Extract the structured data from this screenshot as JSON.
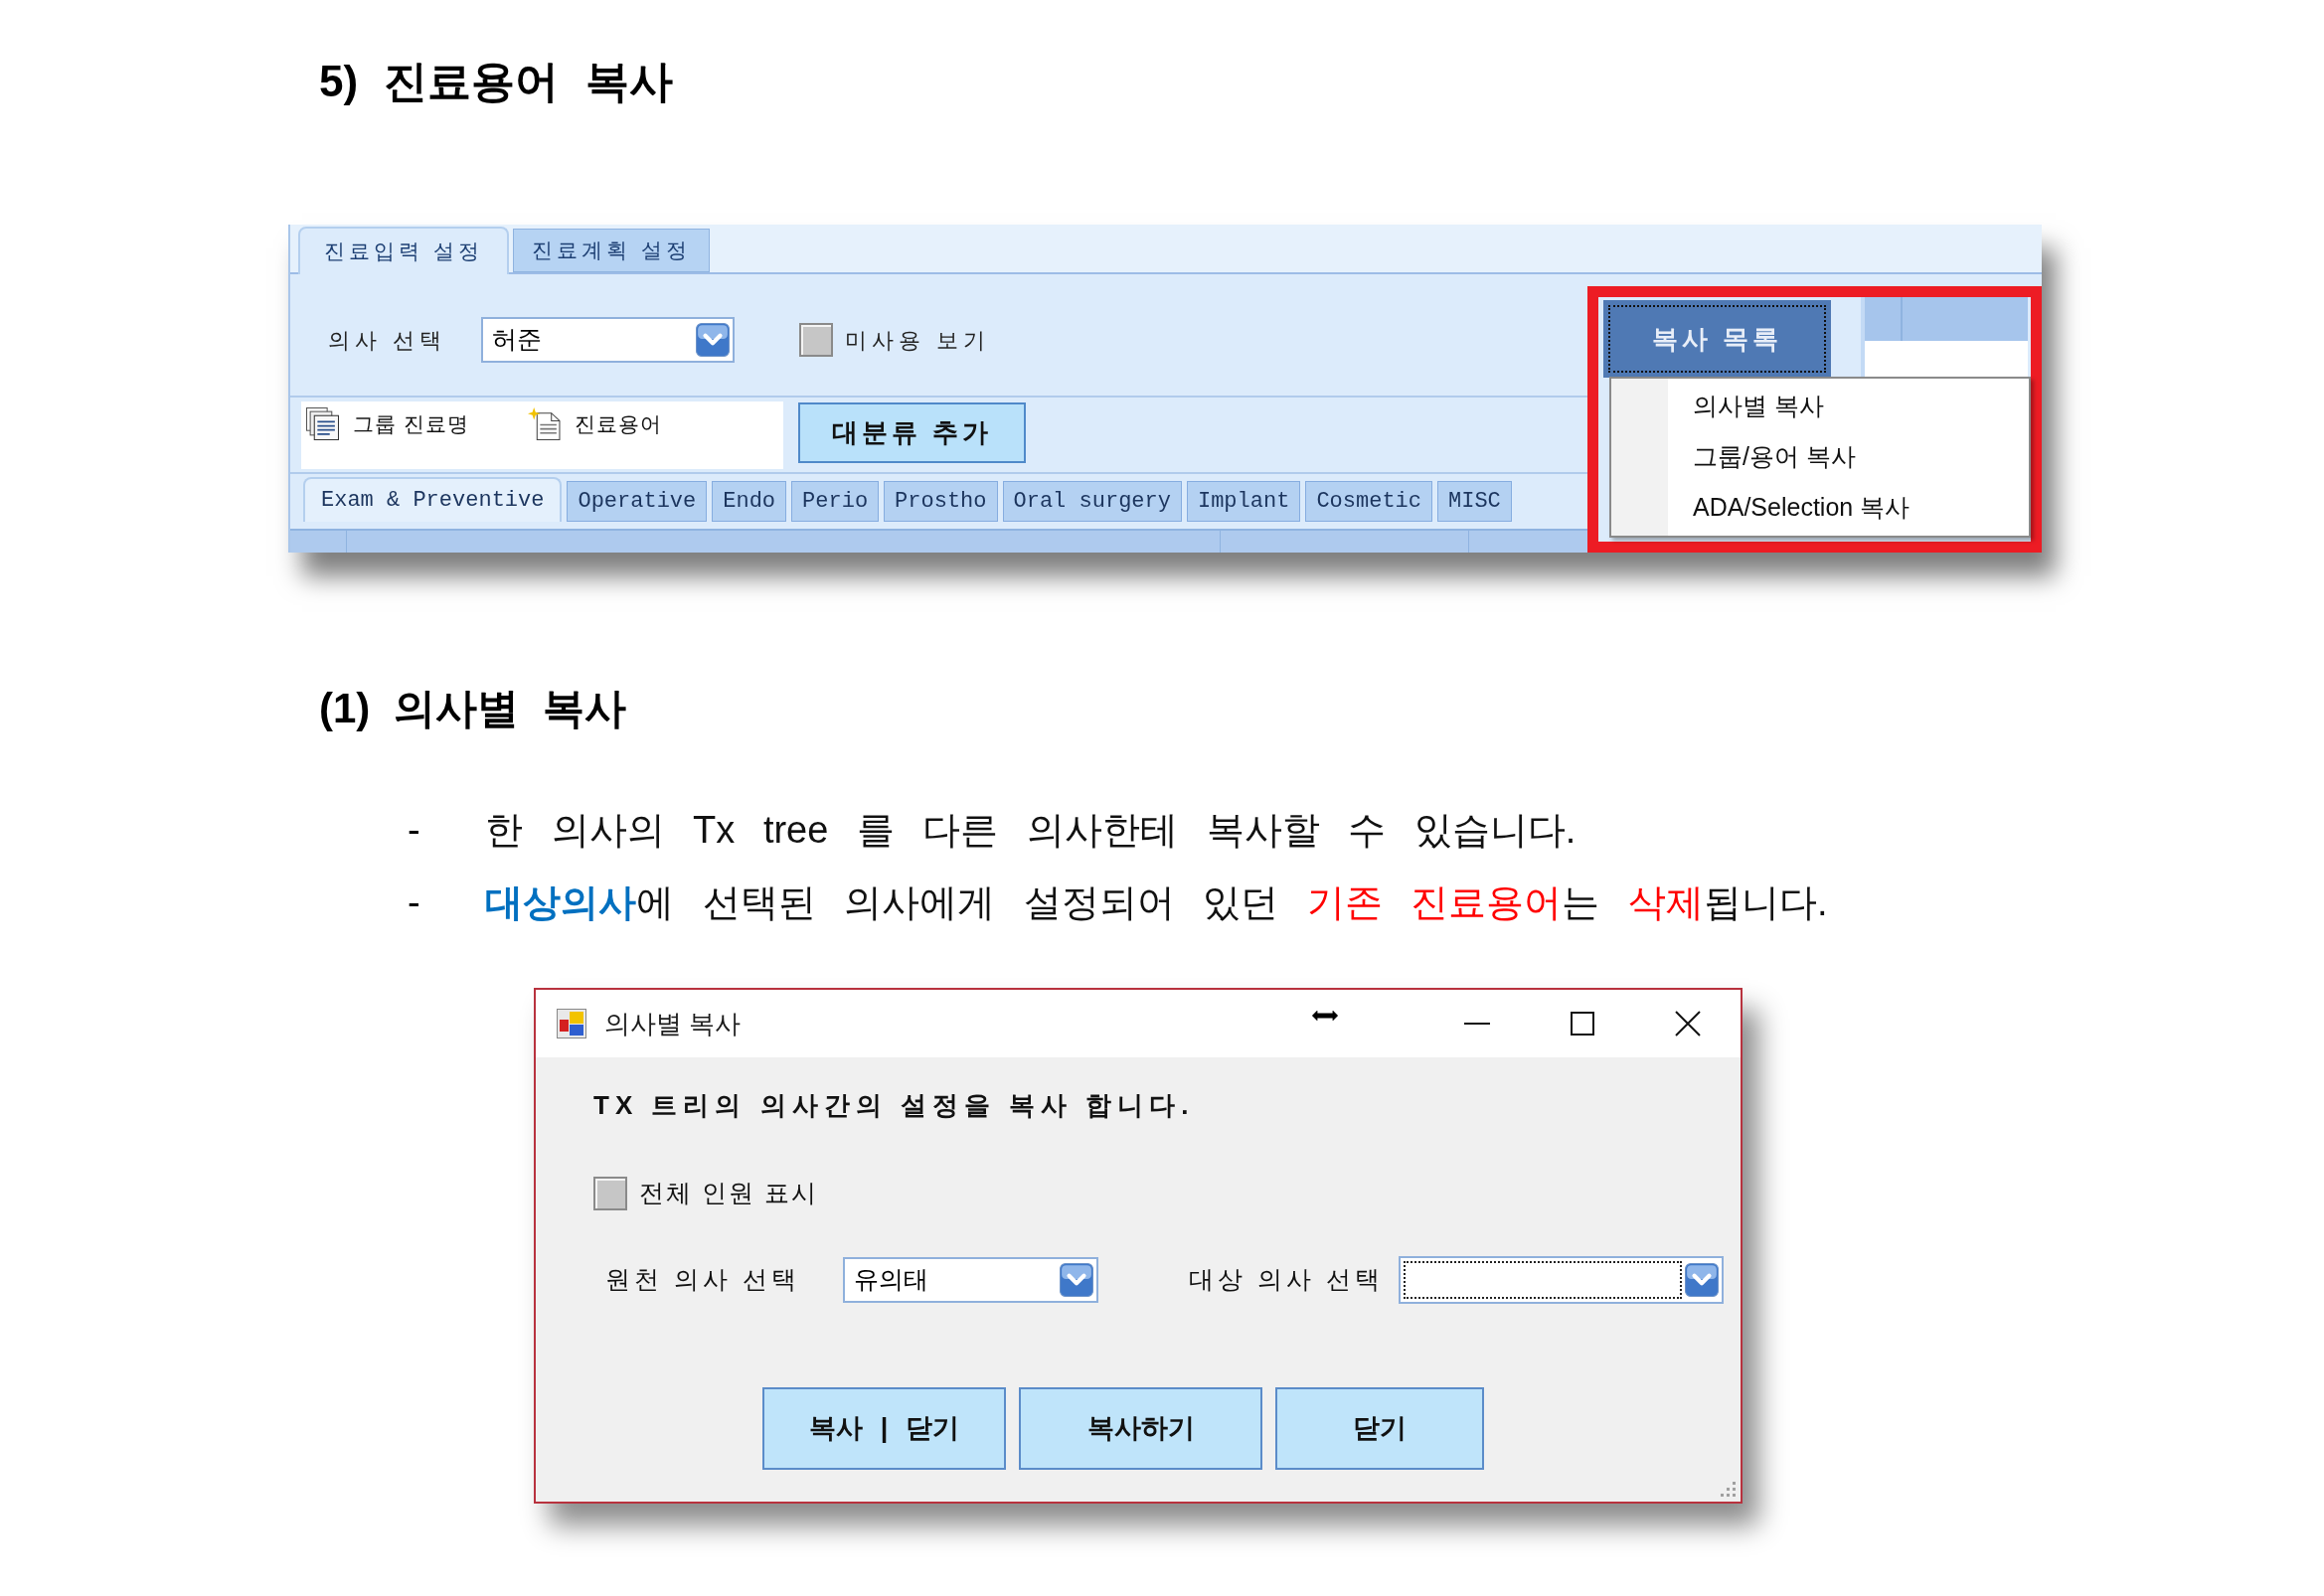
{
  "heading": "5) 진료용어 복사",
  "settings_window": {
    "tabs": [
      {
        "label": "진료입력 설정",
        "selected": true
      },
      {
        "label": "진료계획 설정",
        "selected": false
      }
    ],
    "doctor_select": {
      "label": "의사 선택",
      "value": "허준"
    },
    "show_unused": {
      "label": "미사용 보기",
      "checked": false
    },
    "tree_toolbar": [
      {
        "kind": "group",
        "label": "그룹 진료명"
      },
      {
        "kind": "term",
        "label": "진료용어"
      }
    ],
    "add_category_button": "대분류 추가",
    "category_tabs": [
      {
        "label": "Exam & Preventive",
        "selected": true
      },
      {
        "label": "Operative",
        "selected": false
      },
      {
        "label": "Endo",
        "selected": false
      },
      {
        "label": "Perio",
        "selected": false
      },
      {
        "label": "Prostho",
        "selected": false
      },
      {
        "label": "Oral surgery",
        "selected": false
      },
      {
        "label": "Implant",
        "selected": false
      },
      {
        "label": "Cosmetic",
        "selected": false
      },
      {
        "label": "MISC",
        "selected": false
      }
    ],
    "copy_menu": {
      "button": {
        "label": "복사 목록",
        "focused": true
      },
      "expanded": true,
      "items": [
        {
          "label": "의사별 복사"
        },
        {
          "label": "그룹/용어 복사"
        },
        {
          "label": "ADA/Selection 복사"
        }
      ]
    }
  },
  "subheading": "(1) 의사별 복사",
  "bullets": [
    {
      "marker": "-",
      "segments": [
        {
          "text": "한 의사의 Tx tree 를 다른 의사한테 복사할 수 있습니다."
        }
      ]
    },
    {
      "marker": "-",
      "segments": [
        {
          "text": "대상의사",
          "color": "#0070c0",
          "bold": true
        },
        {
          "text": "에 선택된 의사에게 설정되어 있던 "
        },
        {
          "text": "기존 진료용어",
          "color": "#ff0000"
        },
        {
          "text": "는 "
        },
        {
          "text": "삭제",
          "color": "#ff0000"
        },
        {
          "text": "됩니다."
        }
      ]
    }
  ],
  "dialog": {
    "title": "의사별 복사",
    "message": "TX 트리의 의사간의 설정을 복사 합니다.",
    "show_all": {
      "label": "전체 인원 표시",
      "checked": false
    },
    "source_doctor": {
      "label": "원천 의사 선택",
      "value": "유의태"
    },
    "target_doctor": {
      "label": "대상 의사 선택",
      "focused": true
    },
    "buttons": [
      {
        "label": "복사 | 닫기"
      },
      {
        "label": "복사하기"
      },
      {
        "label": "닫기"
      }
    ]
  }
}
